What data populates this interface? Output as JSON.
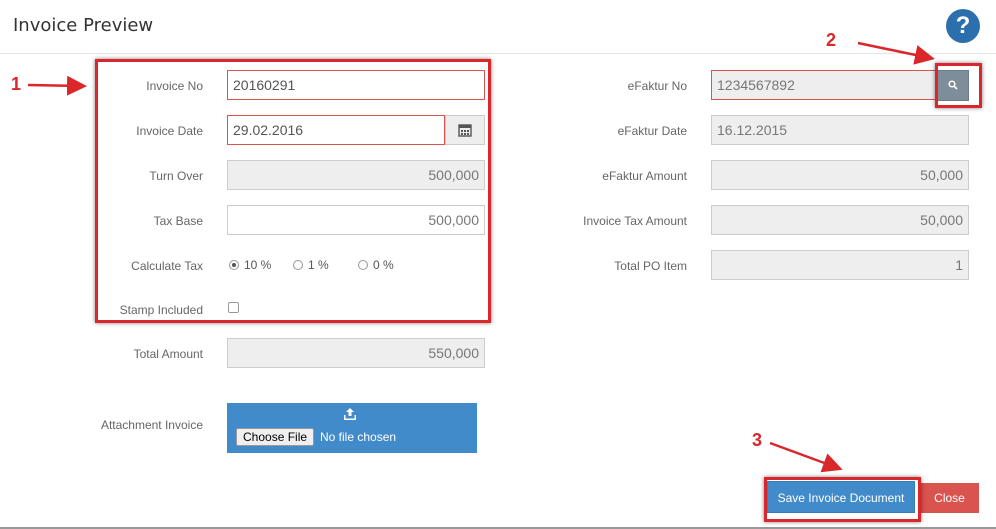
{
  "header": {
    "title": "Invoice Preview",
    "help_glyph": "?"
  },
  "form_left": {
    "invoice_no": {
      "label": "Invoice No",
      "value": "20160291"
    },
    "invoice_date": {
      "label": "Invoice Date",
      "value": "29.02.2016",
      "icon": "calendar-icon"
    },
    "turn_over": {
      "label": "Turn Over",
      "value": "500,000"
    },
    "tax_base": {
      "label": "Tax Base",
      "value": "500,000"
    },
    "calculate_tax": {
      "label": "Calculate Tax",
      "options": [
        "10 %",
        "1 %",
        "0 %"
      ],
      "selected": "10 %"
    },
    "stamp_included": {
      "label": "Stamp Included",
      "checked": false
    },
    "total_amount": {
      "label": "Total Amount",
      "value": "550,000"
    },
    "attachment": {
      "label": "Attachment Invoice",
      "button": "Choose File",
      "status": "No file chosen",
      "icon": "upload-icon"
    }
  },
  "form_right": {
    "efaktur_no": {
      "label": "eFaktur No",
      "value": "1234567892",
      "icon": "search-icon"
    },
    "efaktur_date": {
      "label": "eFaktur Date",
      "value": "16.12.2015"
    },
    "efaktur_amount": {
      "label": "eFaktur Amount",
      "value": "50,000"
    },
    "invoice_tax_amount": {
      "label": "Invoice Tax Amount",
      "value": "50,000"
    },
    "total_po_item": {
      "label": "Total PO Item",
      "value": "1"
    }
  },
  "footer": {
    "save_label": "Save Invoice Document",
    "close_label": "Close"
  },
  "annotations": {
    "n1": "1",
    "n2": "2",
    "n3": "3"
  },
  "colors": {
    "primary": "#428bca",
    "danger": "#d9534f",
    "annotation": "#d9272b",
    "help": "#2c6fad"
  }
}
